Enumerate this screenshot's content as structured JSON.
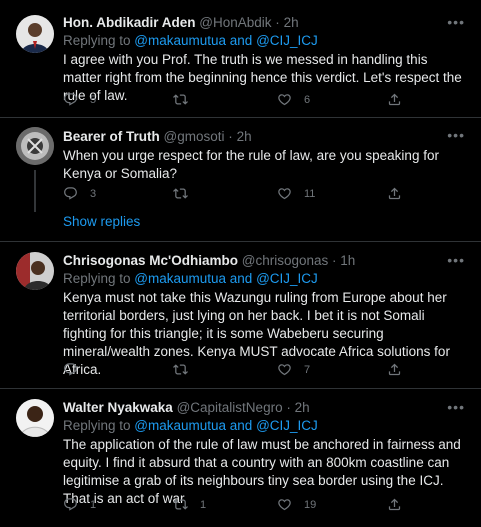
{
  "tweets": [
    {
      "name": "Hon. Abdikadir Aden",
      "handle": "@HonAbdik",
      "time": "2h",
      "replying_prefix": "Replying to ",
      "replying_to": "@makaumutua and @CIJ_ICJ",
      "text": "I agree with you Prof. The truth is we messed in handling this matter right from the beginning hence this verdict. Let's respect the rule of law.",
      "replies": "5",
      "retweets": "",
      "likes": "6"
    },
    {
      "name": "Bearer of Truth",
      "handle": "@gmosoti",
      "time": "2h",
      "text": "When you urge respect for the rule of law, are you speaking for Kenya or Somalia?",
      "replies": "3",
      "retweets": "",
      "likes": "11",
      "show_replies": "Show replies"
    },
    {
      "name": "Chrisogonas Mc'Odhiambo",
      "handle": "@chrisogonas",
      "time": "1h",
      "replying_prefix": "Replying to ",
      "replying_to": "@makaumutua and @CIJ_ICJ",
      "text": "Kenya must not take this Wazungu ruling from Europe about her territorial borders, just lying on her back. I bet it is not Somali fighting for this triangle; it is some Wabeberu securing mineral/wealth zones. Kenya MUST advocate Africa solutions for Africa.",
      "replies": "",
      "retweets": "",
      "likes": "7"
    },
    {
      "name": "Walter Nyakwaka",
      "handle": "@CapitalistNegro",
      "time": "2h",
      "replying_prefix": "Replying to ",
      "replying_to": "@makaumutua and @CIJ_ICJ",
      "text": "The application of the rule of law must be anchored in fairness and equity. I find it absurd that a country with an 800km coastline can legitimise a grab of its neighbours tiny sea border using the ICJ. That is an act of war",
      "replies": "1",
      "retweets": "1",
      "likes": "19"
    }
  ],
  "separator": "·",
  "icons": {
    "reply": "reply-icon",
    "retweet": "retweet-icon",
    "like": "heart-icon",
    "share": "share-icon",
    "more": "more-icon"
  },
  "colors": {
    "background": "#000000",
    "text": "#e7e9ea",
    "muted": "#71767b",
    "link": "#1d9bf0",
    "divider": "#2f3336"
  }
}
